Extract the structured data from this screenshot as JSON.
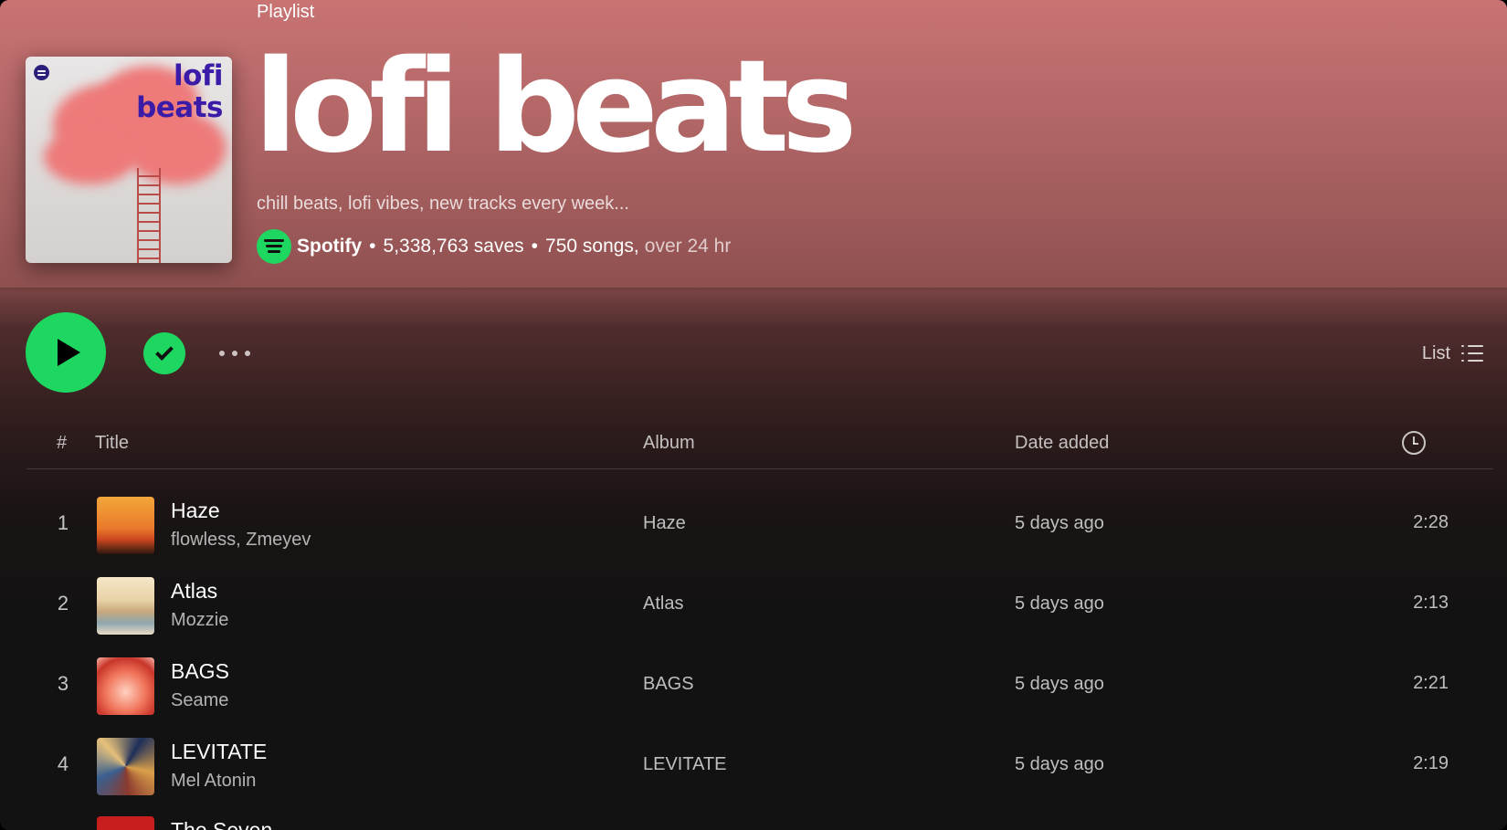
{
  "playlist": {
    "type_label": "Playlist",
    "title": "lofi beats",
    "cover_text_line1": "lofi",
    "cover_text_line2": "beats",
    "description": "chill beats, lofi vibes, new tracks every week...",
    "owner": "Spotify",
    "saves": "5,338,763 saves",
    "songs": "750 songs,",
    "duration": "over 24 hr",
    "separator": "•"
  },
  "controls": {
    "view_label": "List",
    "play_icon": "play-icon",
    "saved_icon": "check-icon",
    "more_icon": "more-horizontal-icon",
    "list_icon": "list-view-icon"
  },
  "table": {
    "headers": {
      "number": "#",
      "title": "Title",
      "album": "Album",
      "date_added": "Date added",
      "duration_icon": "clock-icon"
    },
    "rows": [
      {
        "number": "1",
        "title": "Haze",
        "artist": "flowless, Zmeyev",
        "album": "Haze",
        "date_added": "5 days ago",
        "duration": "2:28"
      },
      {
        "number": "2",
        "title": "Atlas",
        "artist": "Mozzie",
        "album": "Atlas",
        "date_added": "5 days ago",
        "duration": "2:13"
      },
      {
        "number": "3",
        "title": "BAGS",
        "artist": "Seame",
        "album": "BAGS",
        "date_added": "5 days ago",
        "duration": "2:21"
      },
      {
        "number": "4",
        "title": "LEVITATE",
        "artist": "Mel Atonin",
        "album": "LEVITATE",
        "date_added": "5 days ago",
        "duration": "2:19"
      }
    ],
    "partial_row": {
      "title": "The Seven"
    }
  },
  "colors": {
    "accent": "#1ed760",
    "header_bg": "#c87272",
    "body_bg": "#121212",
    "cover_text": "#3b1ca8"
  }
}
